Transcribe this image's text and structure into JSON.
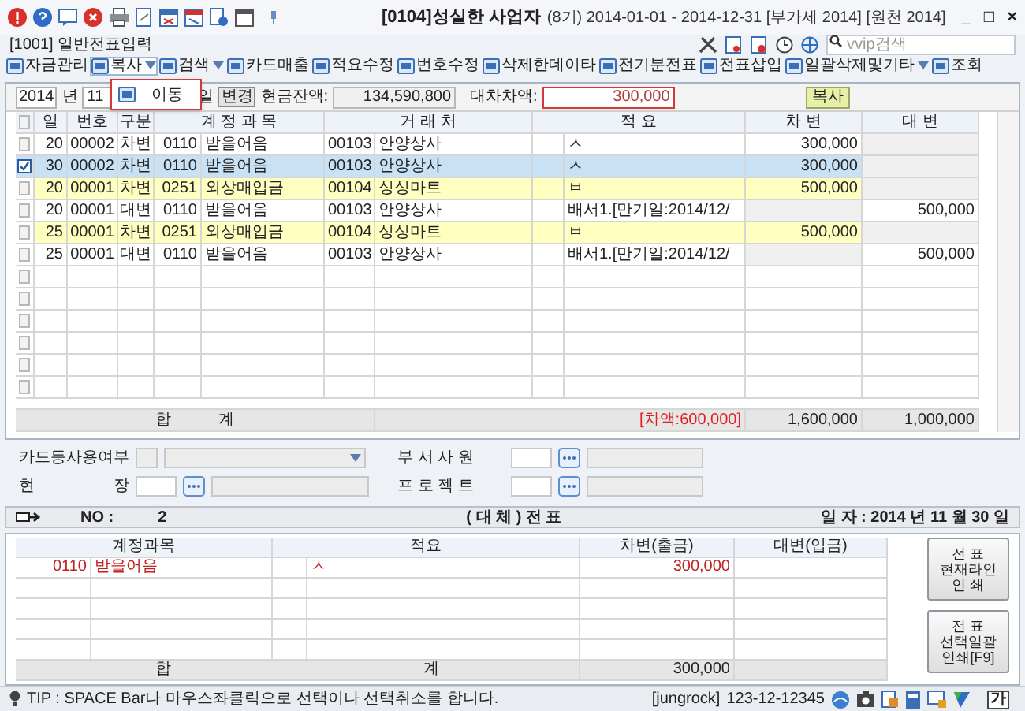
{
  "window": {
    "title": "[0104]성실한 사업자",
    "subtitle": "(8기) 2014-01-01 - 2014-12-31 [부가세 2014] [원천 2014]",
    "controls": [
      "_",
      "□",
      "×"
    ]
  },
  "screen_title": "[1001] 일반전표입력",
  "search": {
    "placeholder": "vvip검색"
  },
  "function_bar": [
    {
      "label": "자금관리",
      "dropdown": false
    },
    {
      "label": "복사",
      "dropdown": true,
      "selected": true
    },
    {
      "label": "검색",
      "dropdown": true,
      "selected": false
    },
    {
      "label": "카드매출",
      "dropdown": false
    },
    {
      "label": "적요수정",
      "dropdown": false
    },
    {
      "label": "번호수정",
      "dropdown": false
    },
    {
      "label": "삭제한데이타",
      "dropdown": false
    },
    {
      "label": "전기분전표",
      "dropdown": false
    },
    {
      "label": "전표삽입",
      "dropdown": false
    },
    {
      "label": "일괄삭제및기타",
      "dropdown": true,
      "selected": false
    },
    {
      "label": "조회",
      "dropdown": false
    }
  ],
  "menu": {
    "items": [
      "이동"
    ]
  },
  "filter": {
    "year": "2014",
    "year_label": "년",
    "month": "11",
    "day_label": "일",
    "change_button": "변경",
    "cash_label": "현금잔액:",
    "cash": "134,590,800",
    "diff_label": "대차차액:",
    "diff": "300,000",
    "copy_button": "복사"
  },
  "table": {
    "select_all_checked": false,
    "columns": [
      "일",
      "번호",
      "구분",
      "계 정 과 목",
      "거 래 처",
      "적 요",
      "차 변",
      "대 변"
    ],
    "rows": [
      {
        "checked": false,
        "selected": false,
        "highlighted": false,
        "day": "20",
        "no": "00002",
        "type": "차변",
        "code": "0110",
        "account": "받을어음",
        "partner_code": "00103",
        "partner": "안양상사",
        "memo": "ㅅ",
        "debit": "300,000",
        "credit": ""
      },
      {
        "checked": true,
        "selected": true,
        "highlighted": false,
        "day": "30",
        "no": "00002",
        "type": "차변",
        "code": "0110",
        "account": "받을어음",
        "partner_code": "00103",
        "partner": "안양상사",
        "memo": "ㅅ",
        "debit": "300,000",
        "credit": ""
      },
      {
        "checked": false,
        "selected": false,
        "highlighted": true,
        "day": "20",
        "no": "00001",
        "type": "차변",
        "code": "0251",
        "account": "외상매입금",
        "partner_code": "00104",
        "partner": "싱싱마트",
        "memo": "ㅂ",
        "debit": "500,000",
        "credit": ""
      },
      {
        "checked": false,
        "selected": false,
        "highlighted": false,
        "day": "20",
        "no": "00001",
        "type": "대변",
        "code": "0110",
        "account": "받을어음",
        "partner_code": "00103",
        "partner": "안양상사",
        "memo": "배서1.[만기일:2014/12/",
        "debit": "",
        "credit": "500,000"
      },
      {
        "checked": false,
        "selected": false,
        "highlighted": true,
        "day": "25",
        "no": "00001",
        "type": "차변",
        "code": "0251",
        "account": "외상매입금",
        "partner_code": "00104",
        "partner": "싱싱마트",
        "memo": "ㅂ",
        "debit": "500,000",
        "credit": ""
      },
      {
        "checked": false,
        "selected": false,
        "highlighted": false,
        "day": "25",
        "no": "00001",
        "type": "대변",
        "code": "0110",
        "account": "받을어음",
        "partner_code": "00103",
        "partner": "안양상사",
        "memo": "배서1.[만기일:2014/12/",
        "debit": "",
        "credit": "500,000"
      }
    ],
    "empty_rows": [
      {
        "checked": false
      },
      {
        "checked": false
      },
      {
        "checked": false
      },
      {
        "checked": false
      },
      {
        "checked": false
      },
      {
        "checked": false
      }
    ],
    "total": {
      "label_1": "합",
      "label_2": "계",
      "diff": "[차액:600,000]",
      "debit": "1,600,000",
      "credit": "1,000,000"
    }
  },
  "form": {
    "card_label": "카드등사용여부",
    "dept_label": "부 서 사 원",
    "site_label": "현",
    "site_label_2": "장",
    "project_label": "프 로 젝 트"
  },
  "voucher": {
    "no_label": "NO :",
    "no": "2",
    "title": "( 대 체 ) 전 표",
    "date": "일 자 : 2014 년 11 월 30 일"
  },
  "voucher_table": {
    "columns": [
      "계정과목",
      "적요",
      "차변(출금)",
      "대변(입금)"
    ],
    "rows": [
      {
        "code": "0110",
        "account": "받을어음",
        "memo": "ㅅ",
        "debit": "300,000",
        "credit": ""
      }
    ],
    "total": {
      "label_1": "합",
      "label_2": "계",
      "debit": "300,000"
    }
  },
  "print_buttons": [
    {
      "lines": [
        "전 표",
        "현재라인",
        "인 쇄"
      ]
    },
    {
      "lines": [
        "전 표",
        "선택일괄",
        "인쇄[F9]"
      ]
    }
  ],
  "status_bar": {
    "tip": "TIP : SPACE Bar나 마우스좌클릭으로 선택이나 선택취소를 합니다.",
    "user": "[jungrock]",
    "biz_no": "123-12-12345",
    "ime": "가"
  }
}
